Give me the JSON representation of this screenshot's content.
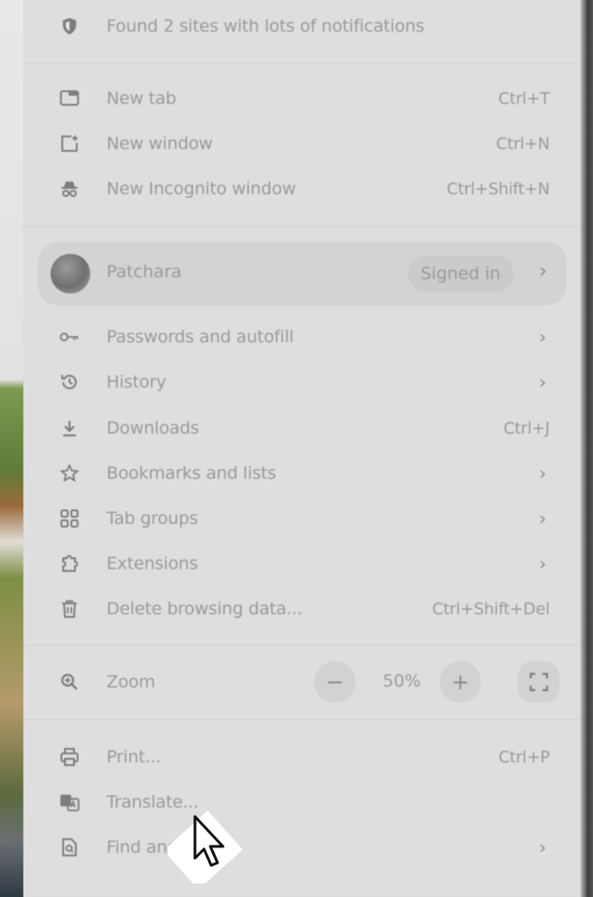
{
  "notification": {
    "text": "Found 2 sites with lots of notifications",
    "icon": "shield-icon"
  },
  "new_items": [
    {
      "label": "New tab",
      "shortcut": "Ctrl+T",
      "icon": "new-tab-icon"
    },
    {
      "label": "New window",
      "shortcut": "Ctrl+N",
      "icon": "new-window-icon"
    },
    {
      "label": "New Incognito window",
      "shortcut": "Ctrl+Shift+N",
      "icon": "incognito-icon"
    }
  ],
  "profile": {
    "name": "Patchara",
    "status": "Signed in",
    "chevron": "›"
  },
  "items": [
    {
      "label": "Passwords and autofill",
      "chevron": "›",
      "icon": "key-icon"
    },
    {
      "label": "History",
      "chevron": "›",
      "icon": "history-icon"
    },
    {
      "label": "Downloads",
      "shortcut": "Ctrl+J",
      "icon": "download-icon"
    },
    {
      "label": "Bookmarks and lists",
      "chevron": "›",
      "icon": "star-icon"
    },
    {
      "label": "Tab groups",
      "chevron": "›",
      "icon": "tab-groups-icon"
    },
    {
      "label": "Extensions",
      "chevron": "›",
      "icon": "puzzle-icon"
    },
    {
      "label": "Delete browsing data...",
      "shortcut": "Ctrl+Shift+Del",
      "icon": "trash-icon"
    }
  ],
  "zoom": {
    "label": "Zoom",
    "minus": "−",
    "value": "50%",
    "plus": "+",
    "icon": "zoom-icon"
  },
  "bottom_items": [
    {
      "label": "Print...",
      "shortcut": "Ctrl+P",
      "icon": "print-icon"
    },
    {
      "label": "Translate...",
      "icon": "translate-icon"
    },
    {
      "label": "Find and",
      "chevron": "›",
      "icon": "find-icon"
    }
  ]
}
